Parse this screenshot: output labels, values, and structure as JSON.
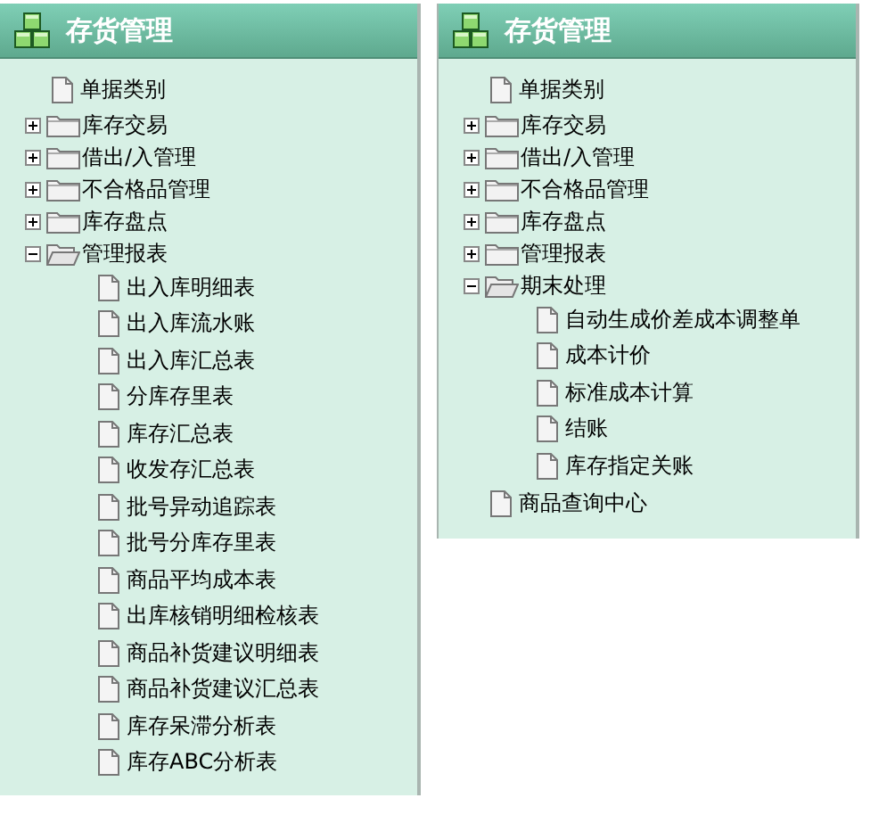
{
  "panels": [
    {
      "title": "存货管理",
      "items": [
        {
          "label": "单据类别",
          "kind": "doc"
        },
        {
          "label": "库存交易",
          "kind": "folder",
          "expanded": false
        },
        {
          "label": "借出/入管理",
          "kind": "folder",
          "expanded": false
        },
        {
          "label": "不合格品管理",
          "kind": "folder",
          "expanded": false
        },
        {
          "label": "库存盘点",
          "kind": "folder",
          "expanded": false
        },
        {
          "label": "管理报表",
          "kind": "folder",
          "expanded": true,
          "children": [
            {
              "label": "出入库明细表",
              "kind": "doc"
            },
            {
              "label": "出入库流水账",
              "kind": "doc"
            },
            {
              "label": "出入库汇总表",
              "kind": "doc"
            },
            {
              "label": "分库存里表",
              "kind": "doc"
            },
            {
              "label": "库存汇总表",
              "kind": "doc"
            },
            {
              "label": "收发存汇总表",
              "kind": "doc"
            },
            {
              "label": "批号异动追踪表",
              "kind": "doc"
            },
            {
              "label": "批号分库存里表",
              "kind": "doc"
            },
            {
              "label": "商品平均成本表",
              "kind": "doc"
            },
            {
              "label": "出库核销明细检核表",
              "kind": "doc"
            },
            {
              "label": "商品补货建议明细表",
              "kind": "doc"
            },
            {
              "label": "商品补货建议汇总表",
              "kind": "doc"
            },
            {
              "label": "库存呆滞分析表",
              "kind": "doc"
            },
            {
              "label": "库存ABC分析表",
              "kind": "doc"
            }
          ]
        }
      ]
    },
    {
      "title": "存货管理",
      "items": [
        {
          "label": "单据类别",
          "kind": "doc"
        },
        {
          "label": "库存交易",
          "kind": "folder",
          "expanded": false
        },
        {
          "label": "借出/入管理",
          "kind": "folder",
          "expanded": false
        },
        {
          "label": "不合格品管理",
          "kind": "folder",
          "expanded": false
        },
        {
          "label": "库存盘点",
          "kind": "folder",
          "expanded": false
        },
        {
          "label": "管理报表",
          "kind": "folder",
          "expanded": false
        },
        {
          "label": "期末处理",
          "kind": "folder",
          "expanded": true,
          "children": [
            {
              "label": "自动生成价差成本调整单",
              "kind": "doc"
            },
            {
              "label": "成本计价",
              "kind": "doc"
            },
            {
              "label": "标准成本计算",
              "kind": "doc"
            },
            {
              "label": "结账",
              "kind": "doc"
            },
            {
              "label": "库存指定关账",
              "kind": "doc"
            }
          ]
        },
        {
          "label": "商品查询中心",
          "kind": "doc"
        }
      ]
    }
  ]
}
